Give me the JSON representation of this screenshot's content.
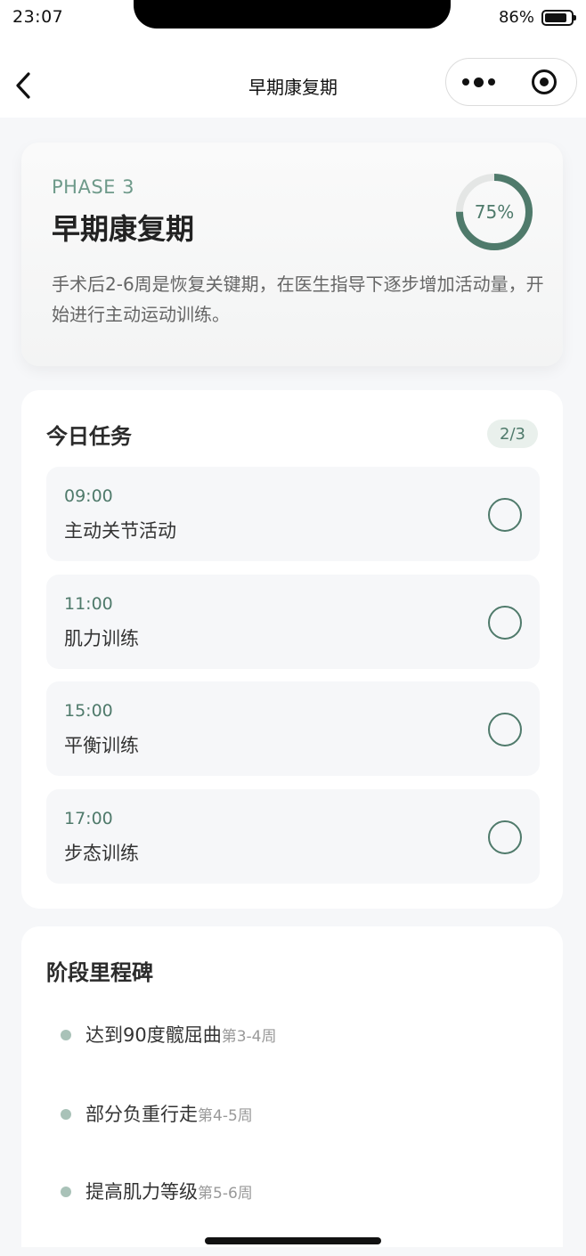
{
  "status_bar": {
    "time": "23:07",
    "battery": "86%",
    "battery_level": 0.86
  },
  "nav": {
    "title": "早期康复期"
  },
  "phase": {
    "label": "PHASE 3",
    "title": "早期康复期",
    "description": "手术后2-6周是恢复关键期，在医生指导下逐步增加活动量，开始进行主动运动训练。",
    "progress_text": "75%",
    "progress_value": 0.75,
    "accent_color": "#4f7a6b"
  },
  "tasks": {
    "title": "今日任务",
    "count": "2/3",
    "items": [
      {
        "time": "09:00",
        "name": "主动关节活动"
      },
      {
        "time": "11:00",
        "name": "肌力训练"
      },
      {
        "time": "15:00",
        "name": "平衡训练"
      },
      {
        "time": "17:00",
        "name": "步态训练"
      }
    ]
  },
  "milestones": {
    "title": "阶段里程碑",
    "items": [
      {
        "name": "达到90度髋屈曲",
        "week": "第3-4周"
      },
      {
        "name": "部分负重行走",
        "week": "第4-5周"
      },
      {
        "name": "提高肌力等级",
        "week": "第5-6周"
      }
    ]
  },
  "icons": {
    "back": "chevron-left-icon",
    "more": "more-dots-icon",
    "close": "target-circle-icon",
    "task_check": "circle-checkbox-icon"
  }
}
